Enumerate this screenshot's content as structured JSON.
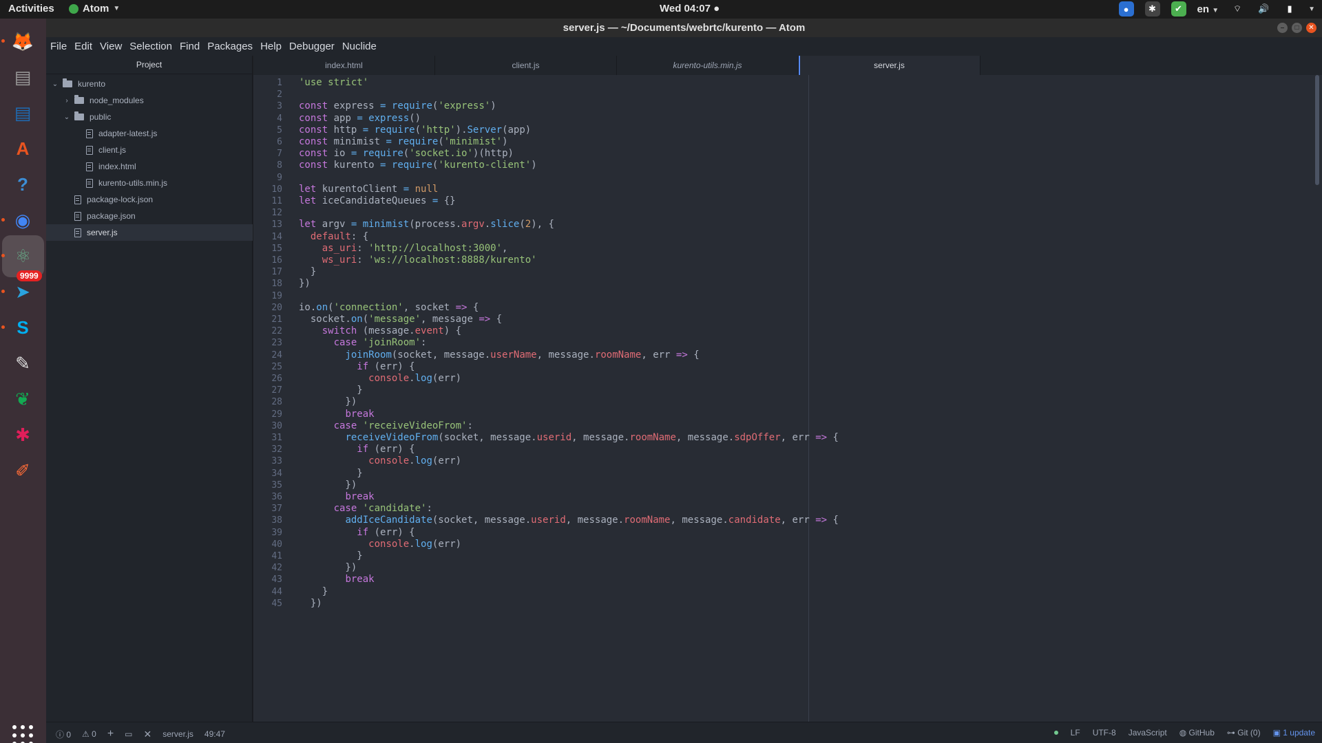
{
  "topbar": {
    "activities": "Activities",
    "app_menu": "Atom",
    "clock": "Wed 04:07 ●",
    "language": "en"
  },
  "window": {
    "title": "server.js — ~/Documents/webrtc/kurento — Atom"
  },
  "dock": {
    "items": [
      {
        "name": "firefox-icon",
        "glyph": "🦊",
        "color": "#e66000"
      },
      {
        "name": "files-icon",
        "glyph": "▤",
        "color": "#9b9b9b"
      },
      {
        "name": "writer-icon",
        "glyph": "▤",
        "color": "#1e6cb6"
      },
      {
        "name": "software-icon",
        "glyph": "A",
        "color": "#e95420"
      },
      {
        "name": "help-icon",
        "glyph": "?",
        "color": "#3c8ed6"
      },
      {
        "name": "chrome-icon",
        "glyph": "◉",
        "color": "#4285f4"
      },
      {
        "name": "atom-icon",
        "glyph": "⚛",
        "color": "#66a886"
      },
      {
        "name": "telegram-icon",
        "glyph": "➤",
        "color": "#2aa3df"
      },
      {
        "name": "skype-icon",
        "glyph": "S",
        "color": "#00aff0"
      },
      {
        "name": "text-editor-icon",
        "glyph": "✎",
        "color": "#e0e0e0"
      },
      {
        "name": "mongodb-compass-icon",
        "glyph": "❦",
        "color": "#13aa52"
      },
      {
        "name": "slack-icon",
        "glyph": "✱",
        "color": "#e01e5a"
      },
      {
        "name": "postman-icon",
        "glyph": "✐",
        "color": "#ff6c37"
      }
    ],
    "telegram_badge": "9999"
  },
  "menubar": [
    "File",
    "Edit",
    "View",
    "Selection",
    "Find",
    "Packages",
    "Help",
    "Debugger",
    "Nuclide"
  ],
  "sidebar": {
    "header": "Project",
    "tree": [
      {
        "label": "kurento",
        "type": "folder",
        "expanded": true,
        "depth": 0
      },
      {
        "label": "node_modules",
        "type": "folder",
        "expanded": false,
        "depth": 1
      },
      {
        "label": "public",
        "type": "folder",
        "expanded": true,
        "depth": 1
      },
      {
        "label": "adapter-latest.js",
        "type": "file",
        "depth": 2
      },
      {
        "label": "client.js",
        "type": "file",
        "depth": 2
      },
      {
        "label": "index.html",
        "type": "file",
        "depth": 2
      },
      {
        "label": "kurento-utils.min.js",
        "type": "file",
        "depth": 2
      },
      {
        "label": "package-lock.json",
        "type": "file",
        "depth": 1
      },
      {
        "label": "package.json",
        "type": "file",
        "depth": 1
      },
      {
        "label": "server.js",
        "type": "file",
        "depth": 1,
        "selected": true
      }
    ]
  },
  "tabs": [
    {
      "label": "index.html",
      "active": false,
      "italic": false
    },
    {
      "label": "client.js",
      "active": false,
      "italic": false
    },
    {
      "label": "kurento-utils.min.js",
      "active": false,
      "italic": true
    },
    {
      "label": "server.js",
      "active": true,
      "italic": false
    }
  ],
  "editor": {
    "first_line_number": 1,
    "lines": [
      [
        [
          "s",
          "'use strict'"
        ]
      ],
      [],
      [
        [
          "k",
          "const"
        ],
        [
          "t",
          " express "
        ],
        [
          "f",
          "="
        ],
        [
          "t",
          " "
        ],
        [
          "f",
          "require"
        ],
        [
          "t",
          "("
        ],
        [
          "s",
          "'express'"
        ],
        [
          "t",
          ")"
        ]
      ],
      [
        [
          "k",
          "const"
        ],
        [
          "t",
          " app "
        ],
        [
          "f",
          "="
        ],
        [
          "t",
          " "
        ],
        [
          "f",
          "express"
        ],
        [
          "t",
          "()"
        ]
      ],
      [
        [
          "k",
          "const"
        ],
        [
          "t",
          " http "
        ],
        [
          "f",
          "="
        ],
        [
          "t",
          " "
        ],
        [
          "f",
          "require"
        ],
        [
          "t",
          "("
        ],
        [
          "s",
          "'http'"
        ],
        [
          "t",
          ")."
        ],
        [
          "f",
          "Server"
        ],
        [
          "t",
          "(app)"
        ]
      ],
      [
        [
          "k",
          "const"
        ],
        [
          "t",
          " minimist "
        ],
        [
          "f",
          "="
        ],
        [
          "t",
          " "
        ],
        [
          "f",
          "require"
        ],
        [
          "t",
          "("
        ],
        [
          "s",
          "'minimist'"
        ],
        [
          "t",
          ")"
        ]
      ],
      [
        [
          "k",
          "const"
        ],
        [
          "t",
          " io "
        ],
        [
          "f",
          "="
        ],
        [
          "t",
          " "
        ],
        [
          "f",
          "require"
        ],
        [
          "t",
          "("
        ],
        [
          "s",
          "'socket.io'"
        ],
        [
          "t",
          ")(http)"
        ]
      ],
      [
        [
          "k",
          "const"
        ],
        [
          "t",
          " kurento "
        ],
        [
          "f",
          "="
        ],
        [
          "t",
          " "
        ],
        [
          "f",
          "require"
        ],
        [
          "t",
          "("
        ],
        [
          "s",
          "'kurento-client'"
        ],
        [
          "t",
          ")"
        ]
      ],
      [],
      [
        [
          "k",
          "let"
        ],
        [
          "t",
          " kurentoClient "
        ],
        [
          "f",
          "="
        ],
        [
          "t",
          " "
        ],
        [
          "n",
          "null"
        ]
      ],
      [
        [
          "k",
          "let"
        ],
        [
          "t",
          " iceCandidateQueues "
        ],
        [
          "f",
          "="
        ],
        [
          "t",
          " {}"
        ]
      ],
      [],
      [
        [
          "k",
          "let"
        ],
        [
          "t",
          " argv "
        ],
        [
          "f",
          "="
        ],
        [
          "t",
          " "
        ],
        [
          "f",
          "minimist"
        ],
        [
          "t",
          "(process."
        ],
        [
          "p",
          "argv"
        ],
        [
          "t",
          "."
        ],
        [
          "f",
          "slice"
        ],
        [
          "t",
          "("
        ],
        [
          "n",
          "2"
        ],
        [
          "t",
          "), {"
        ]
      ],
      [
        [
          "t",
          "  "
        ],
        [
          "p",
          "default"
        ],
        [
          "t",
          ": {"
        ]
      ],
      [
        [
          "t",
          "    "
        ],
        [
          "p",
          "as_uri"
        ],
        [
          "t",
          ": "
        ],
        [
          "s",
          "'http://localhost:3000'"
        ],
        [
          "t",
          ","
        ]
      ],
      [
        [
          "t",
          "    "
        ],
        [
          "p",
          "ws_uri"
        ],
        [
          "t",
          ": "
        ],
        [
          "s",
          "'ws://localhost:8888/kurento'"
        ]
      ],
      [
        [
          "t",
          "  }"
        ]
      ],
      [
        [
          "t",
          "})"
        ]
      ],
      [],
      [
        [
          "t",
          "io."
        ],
        [
          "f",
          "on"
        ],
        [
          "t",
          "("
        ],
        [
          "s",
          "'connection'"
        ],
        [
          "t",
          ", socket "
        ],
        [
          "k",
          "=>"
        ],
        [
          "t",
          " {"
        ]
      ],
      [
        [
          "t",
          "  socket."
        ],
        [
          "f",
          "on"
        ],
        [
          "t",
          "("
        ],
        [
          "s",
          "'message'"
        ],
        [
          "t",
          ", message "
        ],
        [
          "k",
          "=>"
        ],
        [
          "t",
          " {"
        ]
      ],
      [
        [
          "t",
          "    "
        ],
        [
          "k",
          "switch"
        ],
        [
          "t",
          " (message."
        ],
        [
          "p",
          "event"
        ],
        [
          "t",
          ") {"
        ]
      ],
      [
        [
          "t",
          "      "
        ],
        [
          "k",
          "case"
        ],
        [
          "t",
          " "
        ],
        [
          "s",
          "'joinRoom'"
        ],
        [
          "t",
          ":"
        ]
      ],
      [
        [
          "t",
          "        "
        ],
        [
          "f",
          "joinRoom"
        ],
        [
          "t",
          "(socket, message."
        ],
        [
          "p",
          "userName"
        ],
        [
          "t",
          ", message."
        ],
        [
          "p",
          "roomName"
        ],
        [
          "t",
          ", err "
        ],
        [
          "k",
          "=>"
        ],
        [
          "t",
          " {"
        ]
      ],
      [
        [
          "t",
          "          "
        ],
        [
          "k",
          "if"
        ],
        [
          "t",
          " (err) {"
        ]
      ],
      [
        [
          "t",
          "            "
        ],
        [
          "p",
          "console"
        ],
        [
          "t",
          "."
        ],
        [
          "f",
          "log"
        ],
        [
          "t",
          "(err)"
        ]
      ],
      [
        [
          "t",
          "          }"
        ]
      ],
      [
        [
          "t",
          "        })"
        ]
      ],
      [
        [
          "t",
          "        "
        ],
        [
          "k",
          "break"
        ]
      ],
      [
        [
          "t",
          "      "
        ],
        [
          "k",
          "case"
        ],
        [
          "t",
          " "
        ],
        [
          "s",
          "'receiveVideoFrom'"
        ],
        [
          "t",
          ":"
        ]
      ],
      [
        [
          "t",
          "        "
        ],
        [
          "f",
          "receiveVideoFrom"
        ],
        [
          "t",
          "(socket, message."
        ],
        [
          "p",
          "userid"
        ],
        [
          "t",
          ", message."
        ],
        [
          "p",
          "roomName"
        ],
        [
          "t",
          ", message."
        ],
        [
          "p",
          "sdpOffer"
        ],
        [
          "t",
          ", err "
        ],
        [
          "k",
          "=>"
        ],
        [
          "t",
          " {"
        ]
      ],
      [
        [
          "t",
          "          "
        ],
        [
          "k",
          "if"
        ],
        [
          "t",
          " (err) {"
        ]
      ],
      [
        [
          "t",
          "            "
        ],
        [
          "p",
          "console"
        ],
        [
          "t",
          "."
        ],
        [
          "f",
          "log"
        ],
        [
          "t",
          "(err)"
        ]
      ],
      [
        [
          "t",
          "          }"
        ]
      ],
      [
        [
          "t",
          "        })"
        ]
      ],
      [
        [
          "t",
          "        "
        ],
        [
          "k",
          "break"
        ]
      ],
      [
        [
          "t",
          "      "
        ],
        [
          "k",
          "case"
        ],
        [
          "t",
          " "
        ],
        [
          "s",
          "'candidate'"
        ],
        [
          "t",
          ":"
        ]
      ],
      [
        [
          "t",
          "        "
        ],
        [
          "f",
          "addIceCandidate"
        ],
        [
          "t",
          "(socket, message."
        ],
        [
          "p",
          "userid"
        ],
        [
          "t",
          ", message."
        ],
        [
          "p",
          "roomName"
        ],
        [
          "t",
          ", message."
        ],
        [
          "p",
          "candidate"
        ],
        [
          "t",
          ", err "
        ],
        [
          "k",
          "=>"
        ],
        [
          "t",
          " {"
        ]
      ],
      [
        [
          "t",
          "          "
        ],
        [
          "k",
          "if"
        ],
        [
          "t",
          " (err) {"
        ]
      ],
      [
        [
          "t",
          "            "
        ],
        [
          "p",
          "console"
        ],
        [
          "t",
          "."
        ],
        [
          "f",
          "log"
        ],
        [
          "t",
          "(err)"
        ]
      ],
      [
        [
          "t",
          "          }"
        ]
      ],
      [
        [
          "t",
          "        })"
        ]
      ],
      [
        [
          "t",
          "        "
        ],
        [
          "k",
          "break"
        ]
      ],
      [
        [
          "t",
          "    }"
        ]
      ],
      [
        [
          "t",
          "  })"
        ]
      ]
    ]
  },
  "statusbar": {
    "errors": "0",
    "warnings": "0",
    "file": "server.js",
    "cursor": "49:47",
    "line_ending": "LF",
    "encoding": "UTF-8",
    "grammar": "JavaScript",
    "github": "GitHub",
    "git": "Git (0)",
    "update": "1 update"
  }
}
